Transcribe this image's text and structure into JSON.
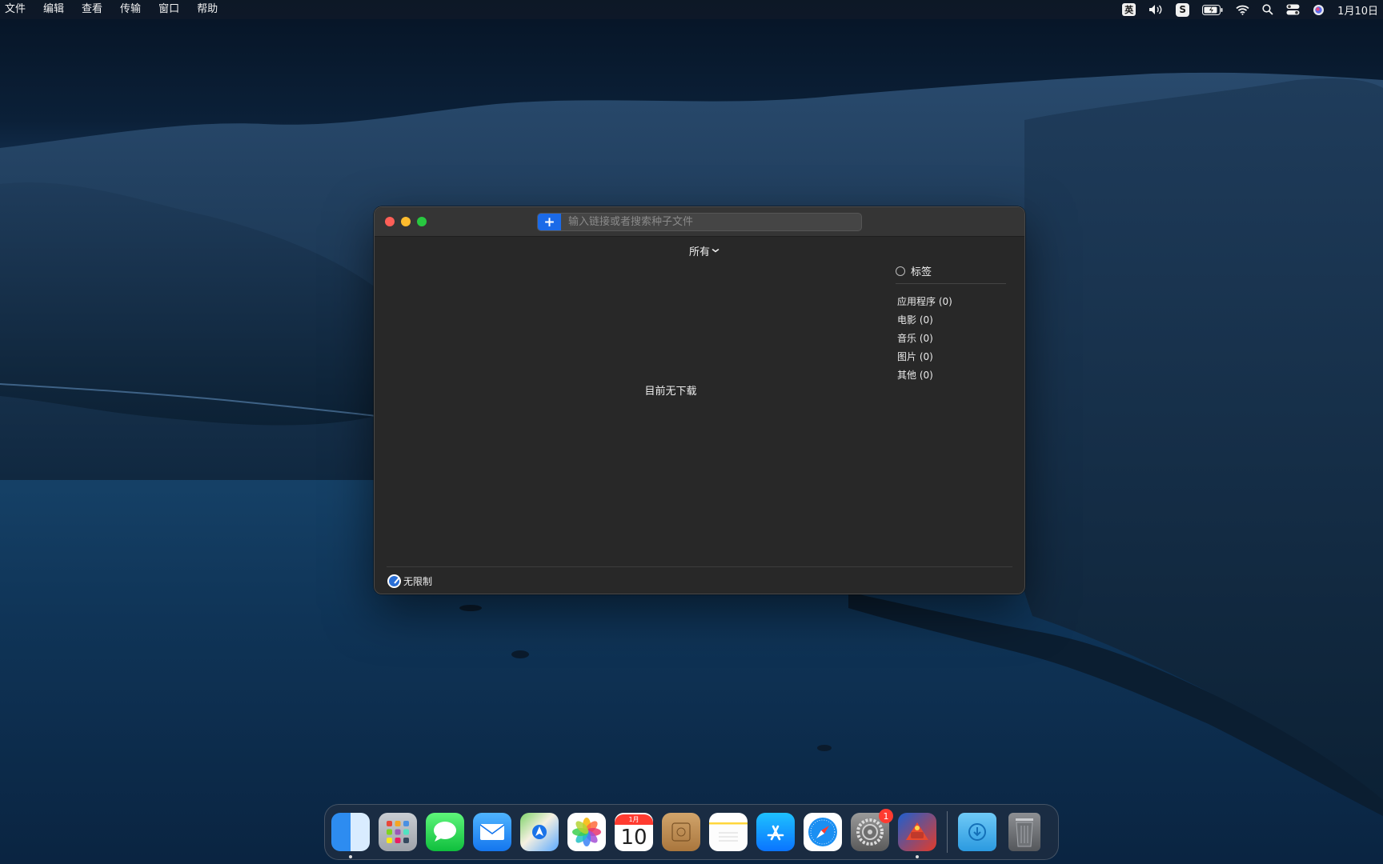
{
  "menubar": {
    "menus": [
      "文件",
      "编辑",
      "查看",
      "传输",
      "窗口",
      "帮助"
    ],
    "status": {
      "ime_label": "英",
      "sogou_label": "S",
      "clock": "1月10日"
    }
  },
  "window": {
    "add_button": "+",
    "search_placeholder": "输入链接或者搜索种子文件",
    "filter_label": "所有",
    "empty_message": "目前无下载",
    "side_panel": {
      "header": "标签",
      "items": [
        {
          "label": "应用程序 (0)"
        },
        {
          "label": "电影 (0)"
        },
        {
          "label": "音乐 (0)"
        },
        {
          "label": "图片 (0)"
        },
        {
          "label": "其他 (0)"
        }
      ]
    },
    "footer": {
      "speed_limit": "无限制"
    }
  },
  "dock": {
    "calendar_month": "1月",
    "calendar_day": "10",
    "prefs_badge": "1"
  }
}
